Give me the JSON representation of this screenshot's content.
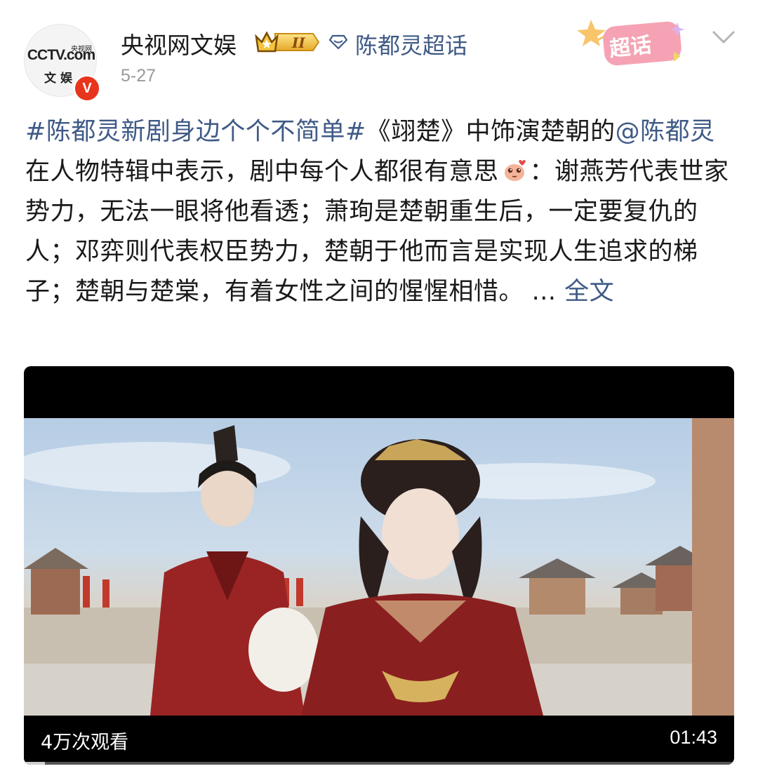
{
  "header": {
    "avatar": {
      "logo_top": "CCTV.com",
      "logo_sub": "央视网",
      "logo_bottom": "文 娱",
      "verified_mark": "V"
    },
    "username": "央视网文娱",
    "level_badge": "II",
    "topic": "陈都灵超话",
    "chaohua_badge": "超话",
    "date": "5-27"
  },
  "post": {
    "hashtag": "#陈都灵新剧身边个个不简单#",
    "text_1": "《翊楚》中饰演楚朝的",
    "mention": "@陈都灵",
    "text_2": " 在人物特辑中表示，剧中每个人都很有意思",
    "text_3": "：谢燕芳代表世家势力，无法一眼将他看透；萧珣是楚朝重生后，一定要复仇的人；邓弈则代表权臣势力，楚朝于他而言是实现人生追求的梯子；楚朝与楚棠，有着女性之间的惺惺相惜。 ... ",
    "read_more": "全文"
  },
  "video": {
    "views": "4万次观看",
    "duration": "01:43",
    "progress": 0.03
  },
  "colors": {
    "link": "#3f5a86",
    "verified": "#e8341c",
    "meta_gray": "#9a9a9a"
  },
  "icons": [
    "cctv-logo-icon",
    "verified-v-icon",
    "crown-level-icon",
    "topic-diamond-icon",
    "chaohua-icon",
    "chevron-down-icon",
    "emoji-icon"
  ]
}
